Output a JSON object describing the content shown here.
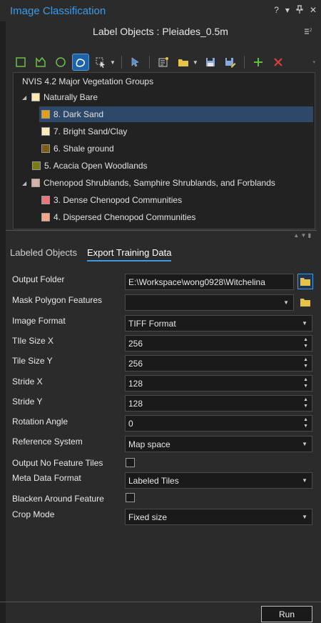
{
  "window": {
    "title": "Image Classification",
    "help": "?",
    "menu_caret": "▾",
    "pin": "⊥",
    "close": "✕"
  },
  "header": {
    "title": "Label Objects : Pleiades_0.5m"
  },
  "toolbar": {
    "icons": [
      "rectangle-tool-icon",
      "polygon-tool-icon",
      "circle-tool-icon",
      "freehand-tool-icon",
      "autodetect-tool-icon",
      "select-segment-icon",
      "label-schema-icon",
      "open-folder-icon",
      "save-icon",
      "save-as-icon",
      "add-class-icon",
      "remove-class-icon"
    ]
  },
  "tree": {
    "root": "NVIS 4.2 Major Vegetation Groups",
    "items": [
      {
        "label": "Naturally Bare",
        "color": "#fde9b0",
        "level": 1,
        "expander": "◢"
      },
      {
        "label": "8. Dark Sand",
        "color": "#e5a01e",
        "level": 2,
        "selected": true
      },
      {
        "label": "7. Bright Sand/Clay",
        "color": "#fdedbe",
        "level": 2
      },
      {
        "label": "6. Shale ground",
        "color": "#7a5c16",
        "level": 2
      },
      {
        "label": "5. Acacia Open Woodlands",
        "color": "#7c7a12",
        "level": 1
      },
      {
        "label": "Chenopod Shrublands, Samphire Shrublands, and Forblands",
        "color": "#d9b0a7",
        "level": 1,
        "expander": "◢"
      },
      {
        "label": "3. Dense Chenopod Communities",
        "color": "#e9767a",
        "level": 2
      },
      {
        "label": "4. Dispersed Chenopod Communities",
        "color": "#f6a585",
        "level": 2
      }
    ]
  },
  "tabs": {
    "labeled_objects": "Labeled Objects",
    "export_training_data": "Export Training Data"
  },
  "form": {
    "output_folder_label": "Output Folder",
    "output_folder_value": "E:\\Workspace\\wong0928\\Witchelina",
    "mask_polygon_label": "Mask Polygon Features",
    "mask_polygon_value": "",
    "image_format_label": "Image Format",
    "image_format_value": "TIFF Format",
    "tile_size_x_label": "TIle Size X",
    "tile_size_x_value": "256",
    "tile_size_y_label": "Tile Size Y",
    "tile_size_y_value": "256",
    "stride_x_label": "Stride X",
    "stride_x_value": "128",
    "stride_y_label": "Stride Y",
    "stride_y_value": "128",
    "rotation_label": "Rotation Angle",
    "rotation_value": "0",
    "reference_label": "Reference System",
    "reference_value": "Map space",
    "no_feature_tiles_label": "Output No Feature Tiles",
    "no_feature_tiles_checked": false,
    "meta_format_label": "Meta Data Format",
    "meta_format_value": "Labeled Tiles",
    "blacken_label": "Blacken Around Feature",
    "blacken_checked": false,
    "crop_label": "Crop Mode",
    "crop_value": "Fixed size"
  },
  "footer": {
    "run_label": "Run"
  },
  "colors": {
    "accent": "#3c9be8",
    "selected_row": "#2d4868",
    "background": "#2b2b2b"
  }
}
